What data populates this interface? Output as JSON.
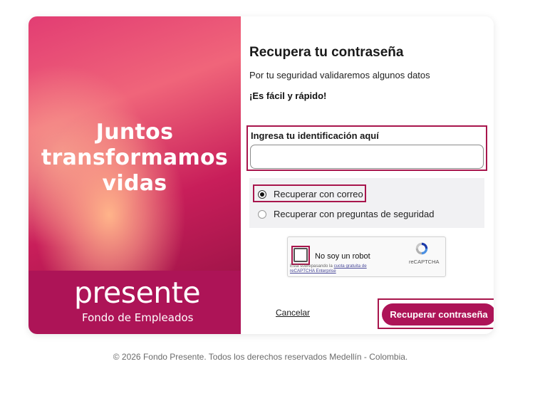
{
  "hero": {
    "lines": [
      "Juntos",
      "transformamos",
      "vidas"
    ],
    "brand_name": "presente",
    "brand_subtitle": "Fondo de Empleados"
  },
  "form": {
    "title": "Recupera tu contraseña",
    "description": "Por tu seguridad validaremos algunos datos",
    "tagline": "¡Es fácil y rápido!",
    "id_label": "Ingresa tu identificación aquí",
    "id_value": "",
    "id_placeholder": "",
    "options": [
      {
        "label": "Recuperar con correo",
        "selected": true
      },
      {
        "label": "Recuperar con preguntas de seguridad",
        "selected": false
      }
    ],
    "captcha": {
      "label": "No soy un robot",
      "brand": "reCAPTCHA",
      "footer_prefix": "Está sobrepasando la",
      "footer_link": "cuota gratuita de reCAPTCHA Enterprise",
      "icon": "recaptcha-logo-icon"
    },
    "cancel_label": "Cancelar",
    "submit_label": "Recuperar contraseña"
  },
  "footer": {
    "text": "© 2026 Fondo Presente. Todos los derechos reservados Medellín - Colombia."
  },
  "colors": {
    "brand": "#ad1457",
    "highlight_outline": "#a8154c",
    "options_bg": "#f1f1f3"
  }
}
